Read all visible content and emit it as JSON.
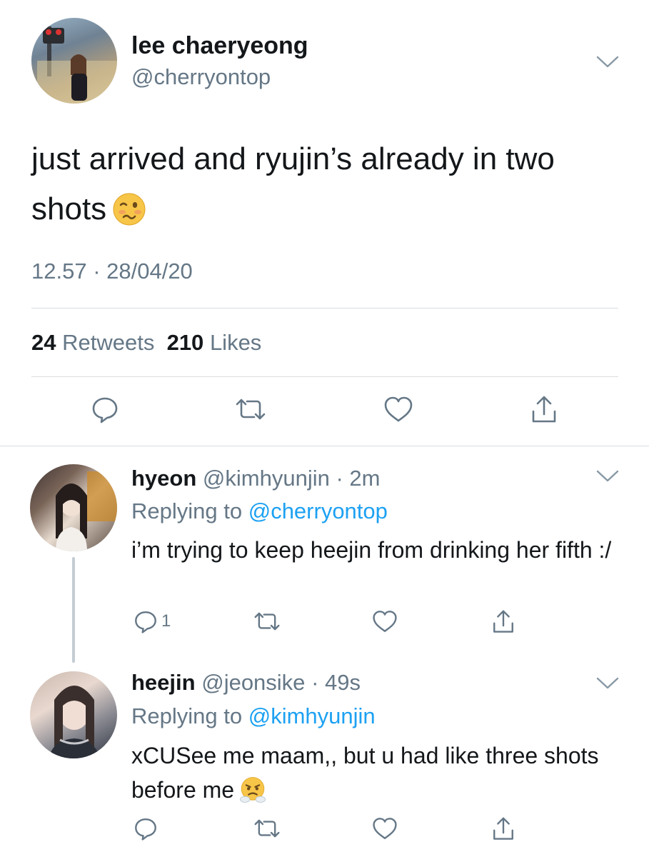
{
  "main_tweet": {
    "name": "lee chaeryeong",
    "handle": "@cherryontop",
    "text": "just arrived and ryujin’s already in two shots",
    "emoji": "woozy-face",
    "timestamp": "12.57 · 28/04/20",
    "retweets_count": "24",
    "retweets_label": "Retweets",
    "likes_count": "210",
    "likes_label": "Likes"
  },
  "replies": [
    {
      "name": "hyeon",
      "handle": "@kimhyunjin",
      "time": "· 2m",
      "replying_prefix": "Replying to",
      "replying_to": "@cherryontop",
      "text": "i’m trying to keep heejin from drinking her fifth :/",
      "reply_count": "1"
    },
    {
      "name": "heejin",
      "handle": "@jeonsike",
      "time": "· 49s",
      "replying_prefix": "Replying to",
      "replying_to": "@kimhyunjin",
      "text": "xCUSee me maam,, but u had like three shots before me",
      "emoji": "face-with-steam-from-nose",
      "reply_count": ""
    }
  ],
  "icons": [
    "reply-icon",
    "retweet-icon",
    "like-icon",
    "share-icon",
    "chevron-down-icon"
  ],
  "colors": {
    "text": "#14171a",
    "secondary": "#657786",
    "link": "#1da1f2",
    "divider": "#d9dde0"
  }
}
